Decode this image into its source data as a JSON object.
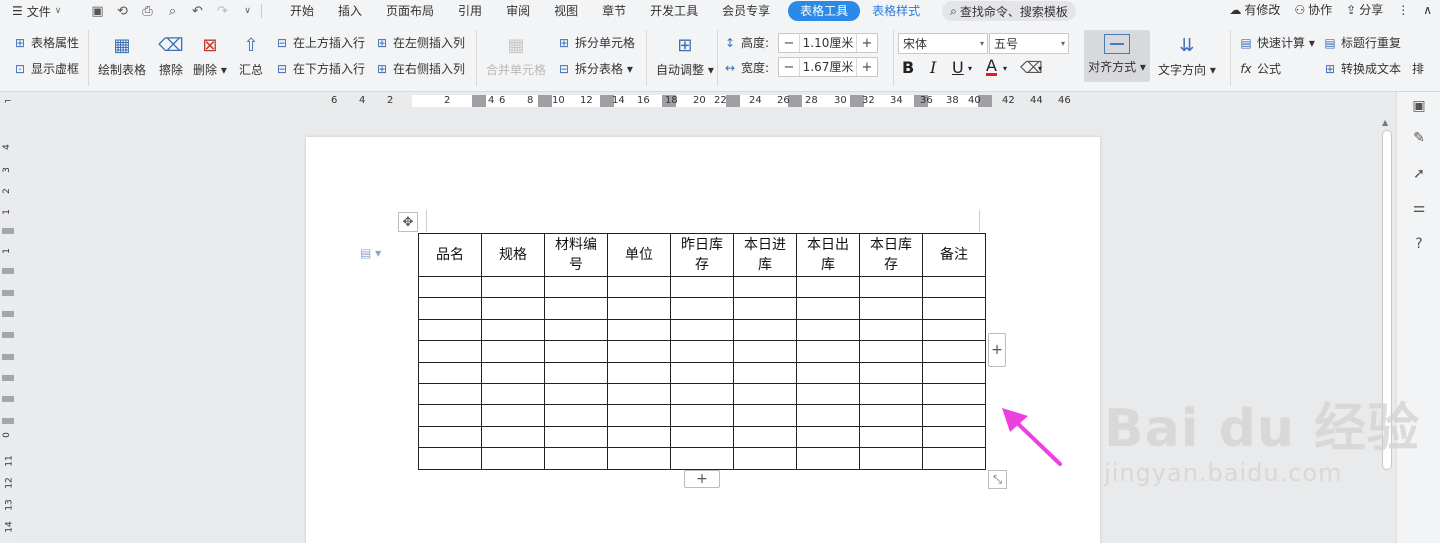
{
  "menubar": {
    "file_label": "文件",
    "tabs": [
      "开始",
      "插入",
      "页面布局",
      "引用",
      "审阅",
      "视图",
      "章节",
      "开发工具",
      "会员专享"
    ],
    "active_tab": "表格工具",
    "style_tab": "表格样式",
    "search_placeholder": "查找命令、搜索模板",
    "modified_label": "有修改",
    "collab_label": "协作",
    "share_label": "分享"
  },
  "ribbon": {
    "table_props": "表格属性",
    "show_gridlines": "显示虚框",
    "draw_table": "绘制表格",
    "erase": "擦除",
    "delete": "删除",
    "summary": "汇总",
    "insert_above": "在上方插入行",
    "insert_below": "在下方插入行",
    "insert_left": "在左侧插入列",
    "insert_right": "在右侧插入列",
    "merge_cells": "合并单元格",
    "split_cells": "拆分单元格",
    "split_table": "拆分表格",
    "auto_fit": "自动调整",
    "height_label": "高度:",
    "height_value": "1.10厘米",
    "width_label": "宽度:",
    "width_value": "1.67厘米",
    "font_name": "宋体",
    "font_size": "五号",
    "align": "对齐方式",
    "text_direction": "文字方向",
    "quick_calc": "快速计算",
    "header_repeat": "标题行重复",
    "formula": "公式",
    "convert_text": "转换成文本",
    "overflow_label": "排"
  },
  "ruler": {
    "h_ticks": [
      "6",
      "4",
      "2",
      "2",
      "4",
      "6",
      "8",
      "10",
      "12",
      "14",
      "16",
      "18",
      "20",
      "22",
      "24",
      "26",
      "28",
      "30",
      "32",
      "34",
      "36",
      "38",
      "40",
      "42",
      "44",
      "46"
    ],
    "v_ticks": [
      "4",
      "3",
      "2",
      "1",
      "1",
      "0",
      "11",
      "12",
      "13",
      "14"
    ]
  },
  "table": {
    "headers": [
      [
        "品名"
      ],
      [
        "规格"
      ],
      [
        "材料编",
        "号"
      ],
      [
        "单位"
      ],
      [
        "昨日库",
        "存"
      ],
      [
        "本日进",
        "库"
      ],
      [
        "本日出",
        "库"
      ],
      [
        "本日库",
        "存"
      ],
      [
        "备注"
      ]
    ],
    "empty_rows": 9
  },
  "icons": {
    "add_column": "plus-icon",
    "add_row": "plus-icon",
    "resize": "diagonal-resize-icon",
    "move": "move-arrows-icon"
  },
  "annotation": {
    "arrow_color": "#ee3fe0"
  },
  "watermark": {
    "brand": "Bai du 经验",
    "url": "jingyan.baidu.com"
  }
}
